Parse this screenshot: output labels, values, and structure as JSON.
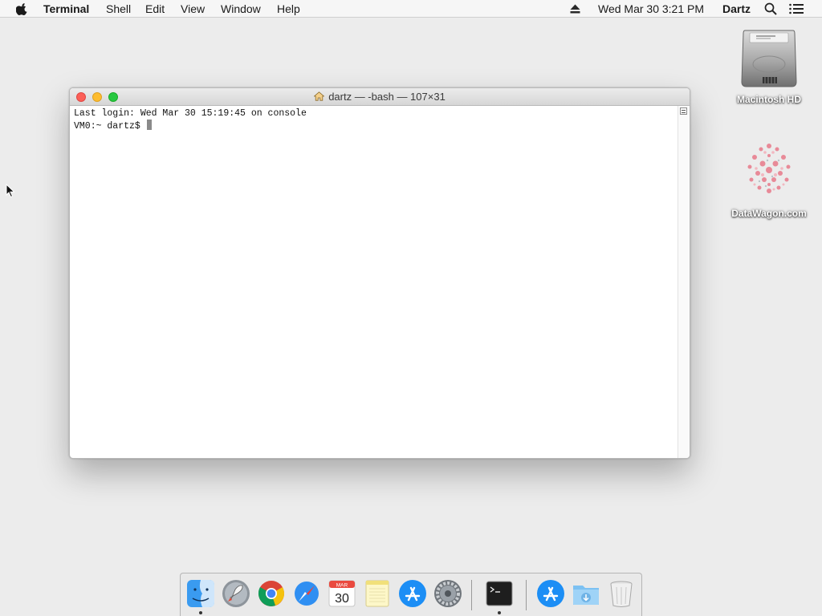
{
  "menubar": {
    "app_name": "Terminal",
    "menus": [
      "Shell",
      "Edit",
      "View",
      "Window",
      "Help"
    ],
    "datetime": "Wed Mar 30  3:21 PM",
    "user": "Dartz"
  },
  "window": {
    "title": "dartz — -bash — 107×31",
    "lines": [
      "Last login: Wed Mar 30 15:19:45 on console",
      "VM0:~ dartz$ "
    ]
  },
  "desktop": {
    "icons": [
      {
        "label": "Macintosh HD",
        "icon": "hard-drive-icon"
      },
      {
        "label": "DataWagon.com",
        "icon": "image-file-icon"
      }
    ]
  },
  "dock": {
    "apps": [
      {
        "icon": "finder-icon",
        "running": true
      },
      {
        "icon": "launchpad-icon",
        "running": false
      },
      {
        "icon": "chrome-icon",
        "running": false
      },
      {
        "icon": "safari-icon",
        "running": false
      },
      {
        "icon": "calendar-icon",
        "running": false,
        "month": "MAR",
        "day": "30"
      },
      {
        "icon": "notes-icon",
        "running": false
      },
      {
        "icon": "app-store-icon",
        "running": false
      },
      {
        "icon": "system-preferences-icon",
        "running": false
      },
      {
        "icon": "terminal-icon",
        "running": true
      },
      {
        "icon": "applications-folder-icon",
        "running": false
      },
      {
        "icon": "downloads-folder-icon",
        "running": false
      },
      {
        "icon": "trash-icon",
        "running": false
      }
    ]
  },
  "colors": {
    "close": "#fc5f57",
    "minimize": "#fdbc2e",
    "zoom": "#27c840",
    "desktop": "#ececec"
  }
}
